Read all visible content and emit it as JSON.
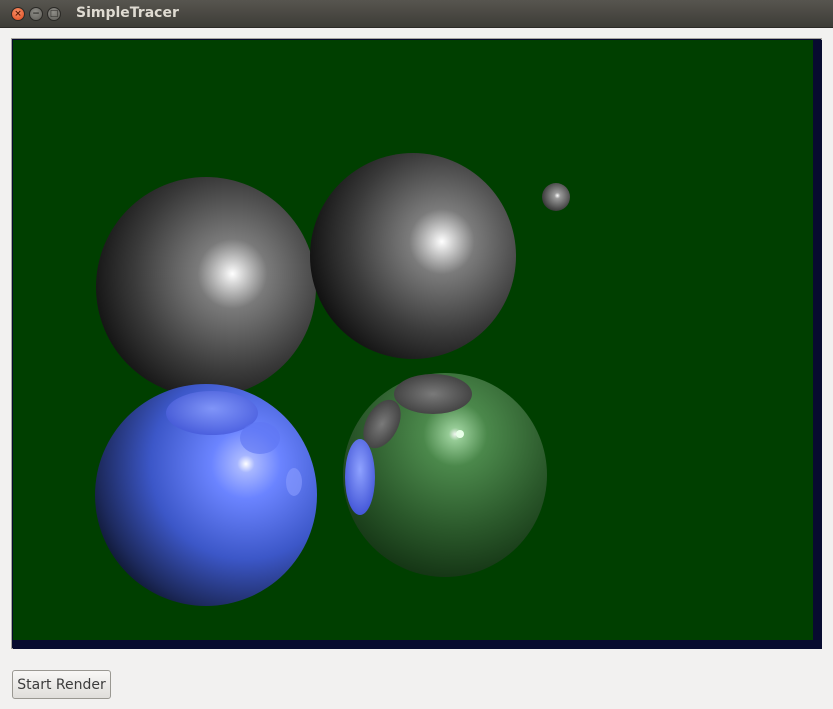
{
  "window": {
    "title": "SimpleTracer",
    "close_glyph": "×",
    "minimize_glyph": "−",
    "maximize_glyph": "□"
  },
  "controls": {
    "start_button_label": "Start Render"
  },
  "scene": {
    "background_color": "#003f00",
    "border_color": "#070b2f",
    "sphere_colors": {
      "gray": "#6e6e6e",
      "blue": "#5a72ff",
      "green": "#3e7a3e"
    }
  }
}
